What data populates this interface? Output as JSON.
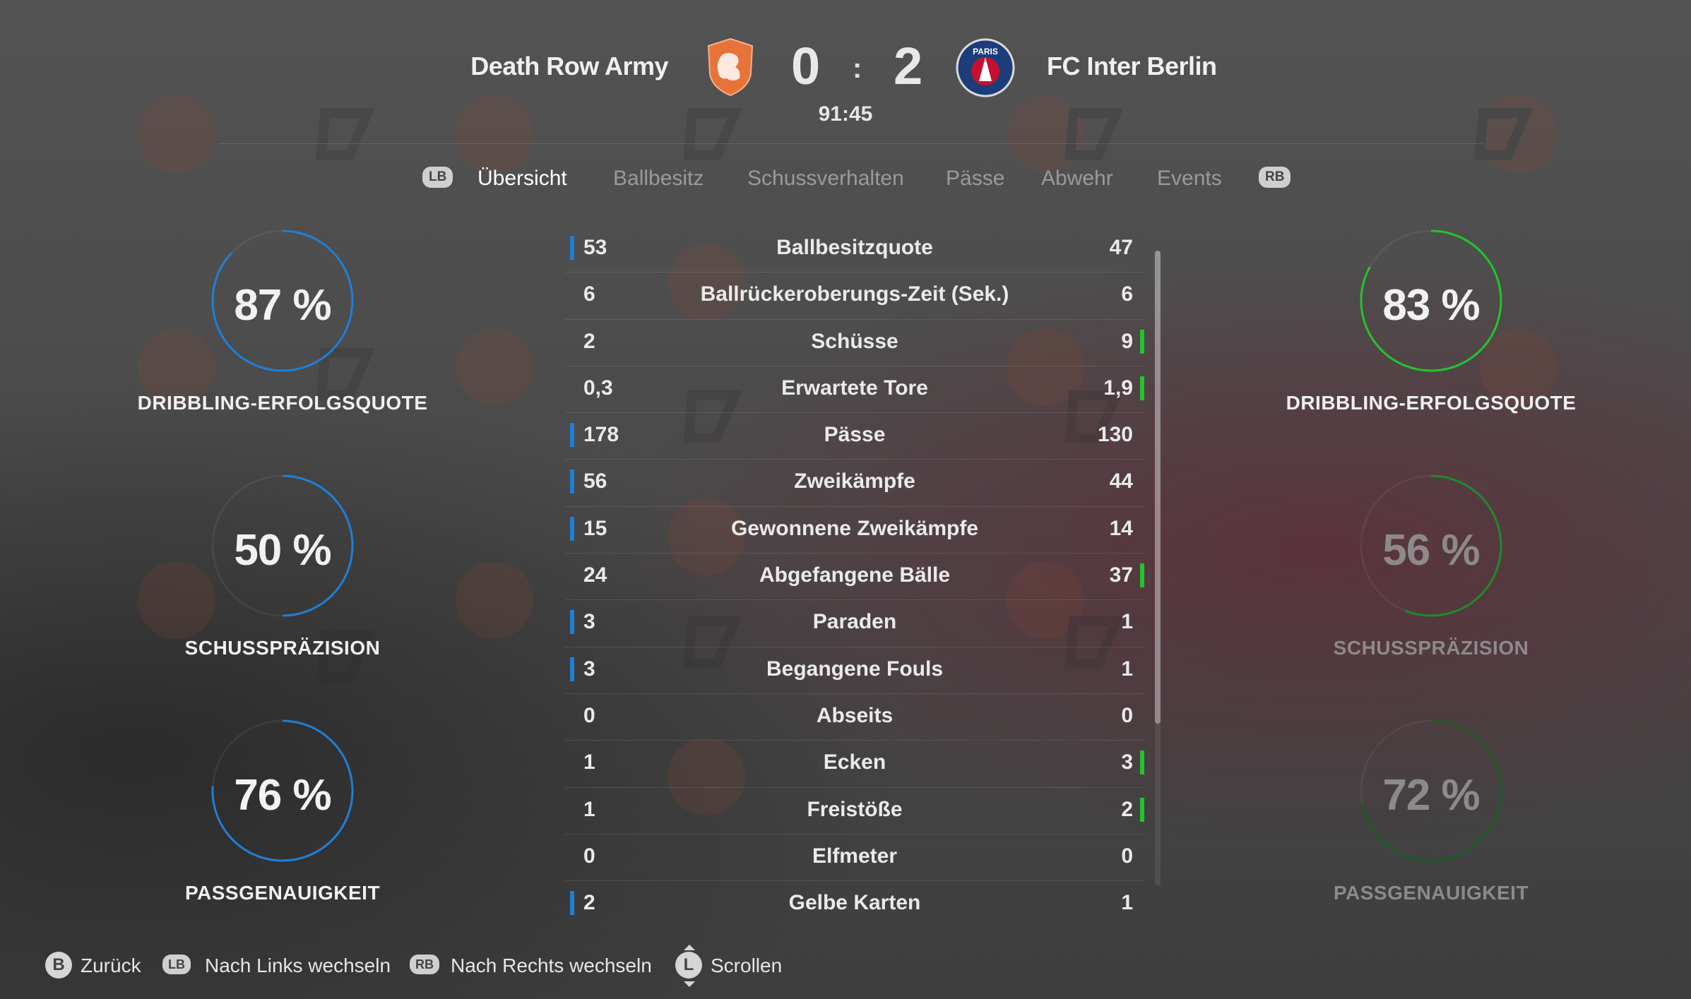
{
  "colors": {
    "home_accent": "#1e7fd6",
    "away_accent": "#22c42c",
    "home_crest": "#e8733a",
    "away_crest": "#1c3d7a"
  },
  "header": {
    "home_team": "Death Row Army",
    "away_team": "FC Inter Berlin",
    "home_score": "0",
    "separator": ":",
    "away_score": "2",
    "clock": "91:45",
    "home_crest_icon": "lion-crest-icon",
    "away_crest_icon": "paris-crest-icon",
    "away_crest_text": "PARIS"
  },
  "tabs": {
    "lb_badge": "LB",
    "rb_badge": "RB",
    "items": [
      {
        "label": "Übersicht",
        "active": true
      },
      {
        "label": "Ballbesitz",
        "active": false
      },
      {
        "label": "Schussverhalten",
        "active": false
      },
      {
        "label": "Pässe",
        "active": false
      },
      {
        "label": "Abwehr",
        "active": false
      },
      {
        "label": "Events",
        "active": false
      }
    ]
  },
  "home_circles": [
    {
      "value": "87 %",
      "label": "DRIBBLING-ERFOLGSQUOTE",
      "percent": 87
    },
    {
      "value": "50 %",
      "label": "SCHUSSPRÄZISION",
      "percent": 50
    },
    {
      "value": "76 %",
      "label": "PASSGENAUIGKEIT",
      "percent": 76
    }
  ],
  "away_circles": [
    {
      "value": "83 %",
      "label": "DRIBBLING-ERFOLGSQUOTE",
      "percent": 83
    },
    {
      "value": "56 %",
      "label": "SCHUSSPRÄZISION",
      "percent": 56
    },
    {
      "value": "72 %",
      "label": "PASSGENAUIGKEIT",
      "percent": 72
    }
  ],
  "stats": [
    {
      "home": "53",
      "label": "Ballbesitzquote",
      "away": "47",
      "leader": "home"
    },
    {
      "home": "6",
      "label": "Ballrückeroberungs-Zeit (Sek.)",
      "away": "6",
      "leader": "none"
    },
    {
      "home": "2",
      "label": "Schüsse",
      "away": "9",
      "leader": "away"
    },
    {
      "home": "0,3",
      "label": "Erwartete Tore",
      "away": "1,9",
      "leader": "away"
    },
    {
      "home": "178",
      "label": "Pässe",
      "away": "130",
      "leader": "home"
    },
    {
      "home": "56",
      "label": "Zweikämpfe",
      "away": "44",
      "leader": "home"
    },
    {
      "home": "15",
      "label": "Gewonnene Zweikämpfe",
      "away": "14",
      "leader": "home"
    },
    {
      "home": "24",
      "label": "Abgefangene Bälle",
      "away": "37",
      "leader": "away"
    },
    {
      "home": "3",
      "label": "Paraden",
      "away": "1",
      "leader": "home"
    },
    {
      "home": "3",
      "label": "Begangene Fouls",
      "away": "1",
      "leader": "home"
    },
    {
      "home": "0",
      "label": "Abseits",
      "away": "0",
      "leader": "none"
    },
    {
      "home": "1",
      "label": "Ecken",
      "away": "3",
      "leader": "away"
    },
    {
      "home": "1",
      "label": "Freistöße",
      "away": "2",
      "leader": "away"
    },
    {
      "home": "0",
      "label": "Elfmeter",
      "away": "0",
      "leader": "none"
    },
    {
      "home": "2",
      "label": "Gelbe Karten",
      "away": "1",
      "leader": "home"
    }
  ],
  "footer": {
    "back_key": "B",
    "back_label": "Zurück",
    "left_key": "LB",
    "left_label": "Nach Links wechseln",
    "right_key": "RB",
    "right_label": "Nach Rechts wechseln",
    "scroll_key": "L",
    "scroll_label": "Scrollen"
  }
}
